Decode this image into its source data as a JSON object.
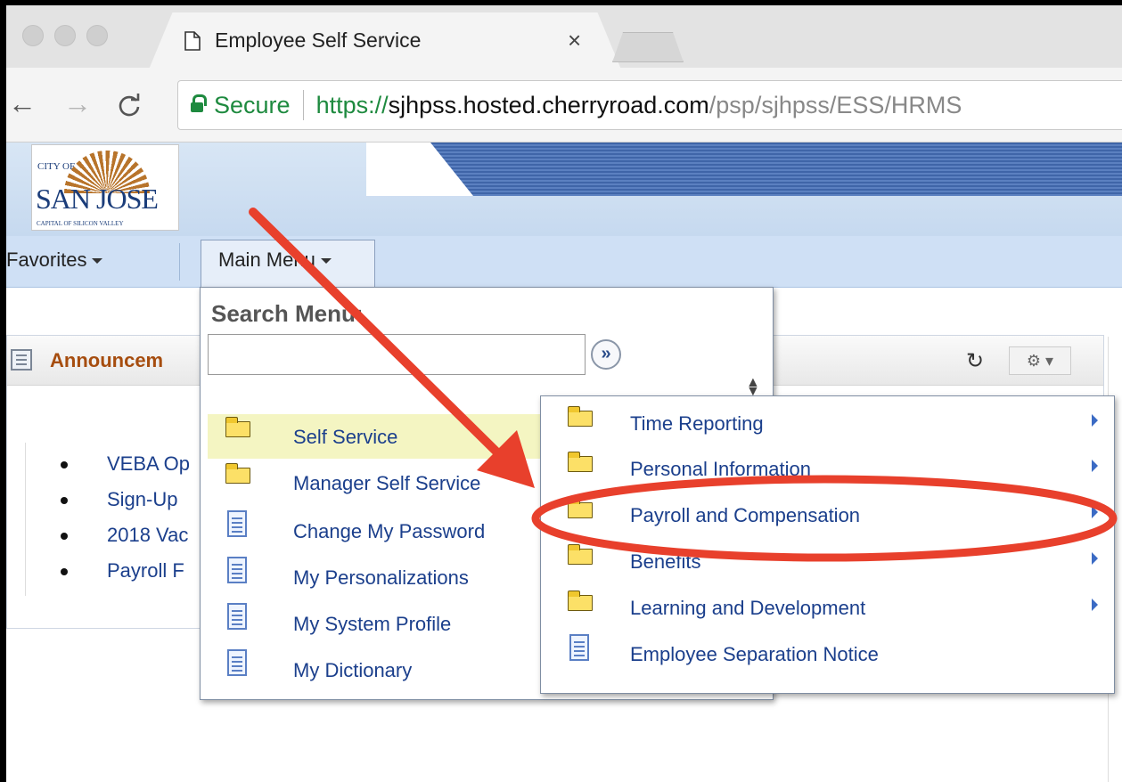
{
  "browser": {
    "tab_title": "Employee Self Service",
    "tab_close": "×",
    "secure_label": "Secure",
    "url_scheme": "https://",
    "url_host": "sjhpss.hosted.cherryroad.com",
    "url_path": "/psp/sjhpss/ESS/HRMS"
  },
  "header": {
    "logo_city_of": "CITY OF",
    "logo_name": "SAN JOSE",
    "logo_tagline": "CAPITAL OF SILICON VALLEY"
  },
  "menubar": {
    "favorites": "Favorites",
    "main_menu": "Main Menu"
  },
  "main_menu": {
    "search_label": "Search Menu:",
    "search_value": "",
    "search_go": "»",
    "items": [
      {
        "label": "Self Service",
        "icon": "folder-icon",
        "selected": true
      },
      {
        "label": "Manager Self Service",
        "icon": "folder-icon"
      },
      {
        "label": "Change My Password",
        "icon": "document-icon"
      },
      {
        "label": "My Personalizations",
        "icon": "document-icon"
      },
      {
        "label": "My System Profile",
        "icon": "document-icon"
      },
      {
        "label": "My Dictionary",
        "icon": "document-icon"
      }
    ]
  },
  "submenu": {
    "items": [
      {
        "label": "Time Reporting",
        "icon": "folder-icon",
        "has_children": true
      },
      {
        "label": "Personal Information",
        "icon": "folder-icon",
        "has_children": true
      },
      {
        "label": "Payroll and Compensation",
        "icon": "folder-icon",
        "has_children": true,
        "highlighted": true
      },
      {
        "label": "Benefits",
        "icon": "folder-icon",
        "has_children": true
      },
      {
        "label": "Learning and Development",
        "icon": "folder-icon",
        "has_children": true
      },
      {
        "label": "Employee Separation Notice",
        "icon": "document-icon",
        "has_children": false
      }
    ]
  },
  "announcements": {
    "title": "Announcem",
    "items": [
      "VEBA Op",
      "Sign-Up",
      "2018 Vac",
      "Payroll F"
    ]
  },
  "annotation": {
    "color": "#e8402c",
    "arrow_target": "Payroll and Compensation"
  }
}
